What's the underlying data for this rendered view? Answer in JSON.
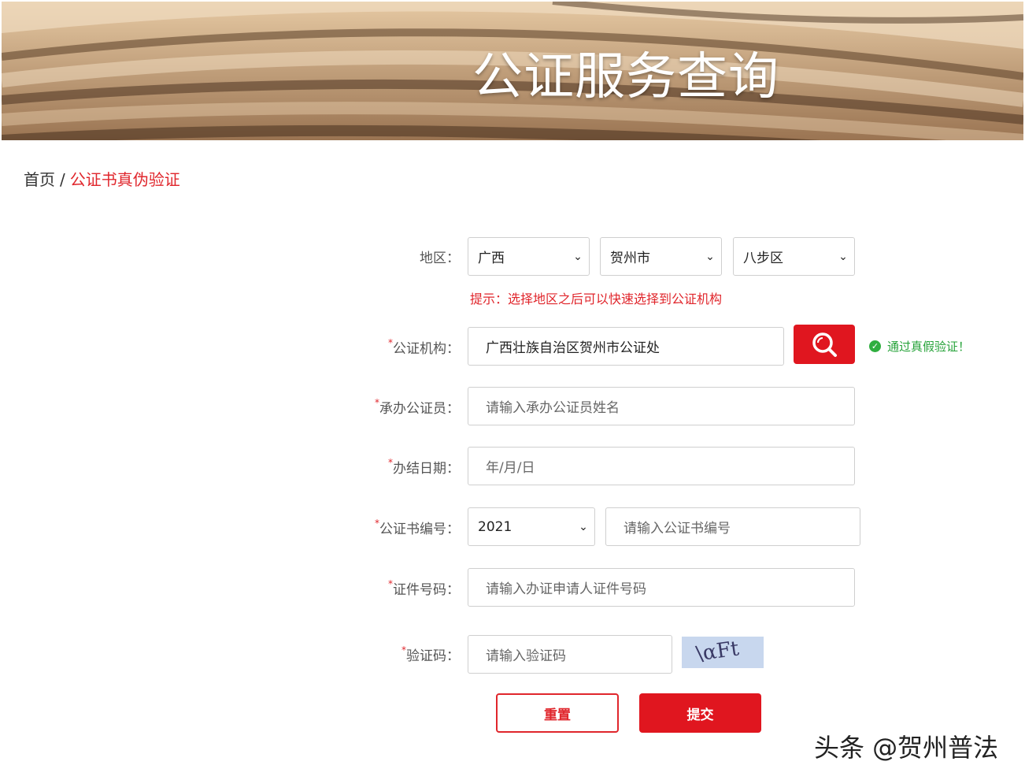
{
  "banner": {
    "title": "公证服务查询"
  },
  "breadcrumb": {
    "home": "首页",
    "separator": "/",
    "current": "公证书真伪验证"
  },
  "form": {
    "region": {
      "label": "地区：",
      "province": "广西",
      "city": "贺州市",
      "district": "八步区",
      "hint": "提示：选择地区之后可以快速选择到公证机构"
    },
    "office": {
      "required_mark": "*",
      "label": "公证机构：",
      "value": "广西壮族自治区贺州市公证处",
      "verified_text": "通过真假验证！"
    },
    "notary": {
      "required_mark": "*",
      "label": "承办公证员：",
      "placeholder": "请输入承办公证员姓名"
    },
    "date": {
      "required_mark": "*",
      "label": "办结日期：",
      "placeholder": "年/月/日"
    },
    "cert_no": {
      "required_mark": "*",
      "label": "公证书编号：",
      "year": "2021",
      "placeholder": "请输入公证书编号"
    },
    "id_no": {
      "required_mark": "*",
      "label": "证件号码：",
      "placeholder": "请输入办证申请人证件号码"
    },
    "captcha": {
      "required_mark": "*",
      "label": "验证码：",
      "placeholder": "请输入验证码",
      "image_text": "\\αFt"
    },
    "reset_label": "重置",
    "submit_label": "提交"
  },
  "watermark": "头条 @贺州普法",
  "icons": {
    "search": "search-icon",
    "dropdown": "chevron-down-icon",
    "verified": "check-circle-icon"
  },
  "colors": {
    "accent": "#e0161f",
    "success": "#27a33a"
  }
}
